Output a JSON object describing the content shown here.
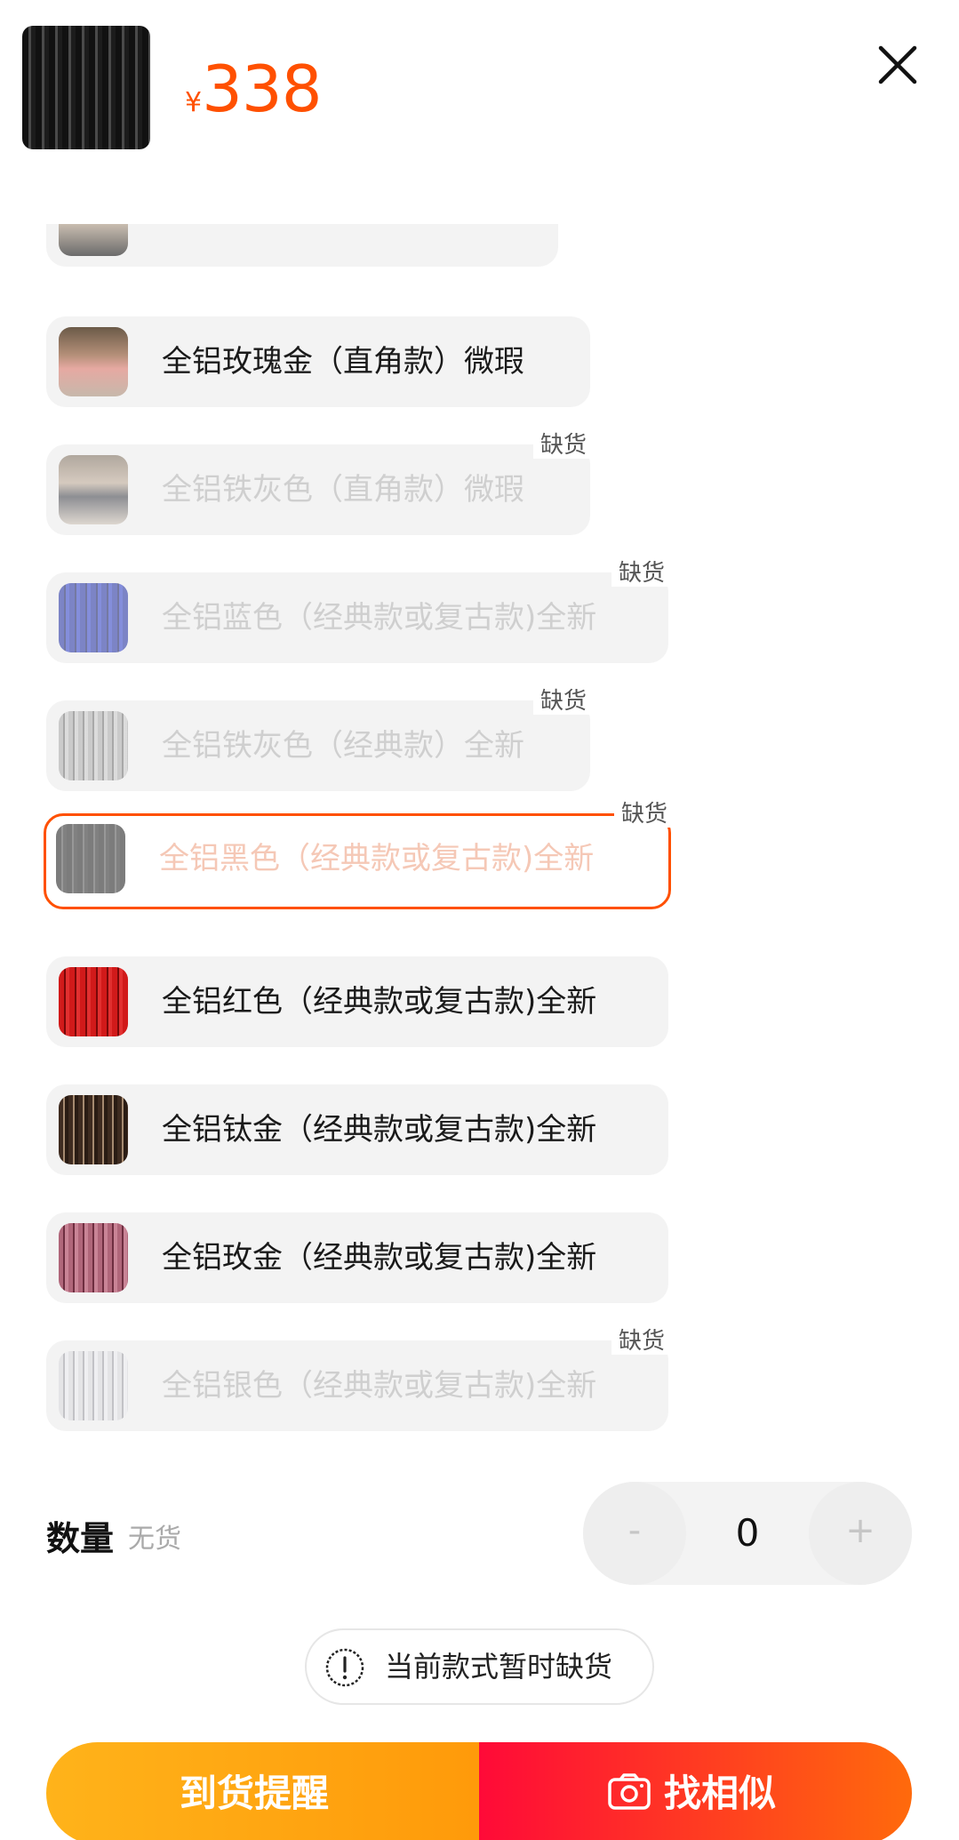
{
  "header": {
    "currency": "¥",
    "price": "338"
  },
  "options": [
    {
      "label": "全铝玫瑰金（直角款）微瑕",
      "status": "",
      "disabled": false,
      "selected": false
    },
    {
      "label": "全铝铁灰色（直角款）微瑕",
      "status": "缺货",
      "disabled": true,
      "selected": false
    },
    {
      "label": "全铝蓝色（经典款或复古款)全新",
      "status": "缺货",
      "disabled": true,
      "selected": false
    },
    {
      "label": "全铝铁灰色（经典款）全新",
      "status": "缺货",
      "disabled": true,
      "selected": false
    },
    {
      "label": "全铝黑色（经典款或复古款)全新",
      "status": "缺货",
      "disabled": true,
      "selected": true
    },
    {
      "label": "全铝红色（经典款或复古款)全新",
      "status": "",
      "disabled": false,
      "selected": false
    },
    {
      "label": "全铝钛金（经典款或复古款)全新",
      "status": "",
      "disabled": false,
      "selected": false
    },
    {
      "label": "全铝玫金（经典款或复古款)全新",
      "status": "",
      "disabled": false,
      "selected": false
    },
    {
      "label": "全铝银色（经典款或复古款)全新",
      "status": "缺货",
      "disabled": true,
      "selected": false
    }
  ],
  "quantity": {
    "label": "数量",
    "status": "无货",
    "minus": "-",
    "value": "0",
    "plus": "+"
  },
  "notice": {
    "text": "当前款式暂时缺货"
  },
  "actions": {
    "remind": "到货提醒",
    "similar": "找相似"
  },
  "colors": {
    "accent": "#ff5000",
    "remind_gradient": [
      "#ffb31a",
      "#ff9a0a"
    ],
    "similar_gradient": [
      "#ff0a38",
      "#ff6a0c"
    ]
  }
}
